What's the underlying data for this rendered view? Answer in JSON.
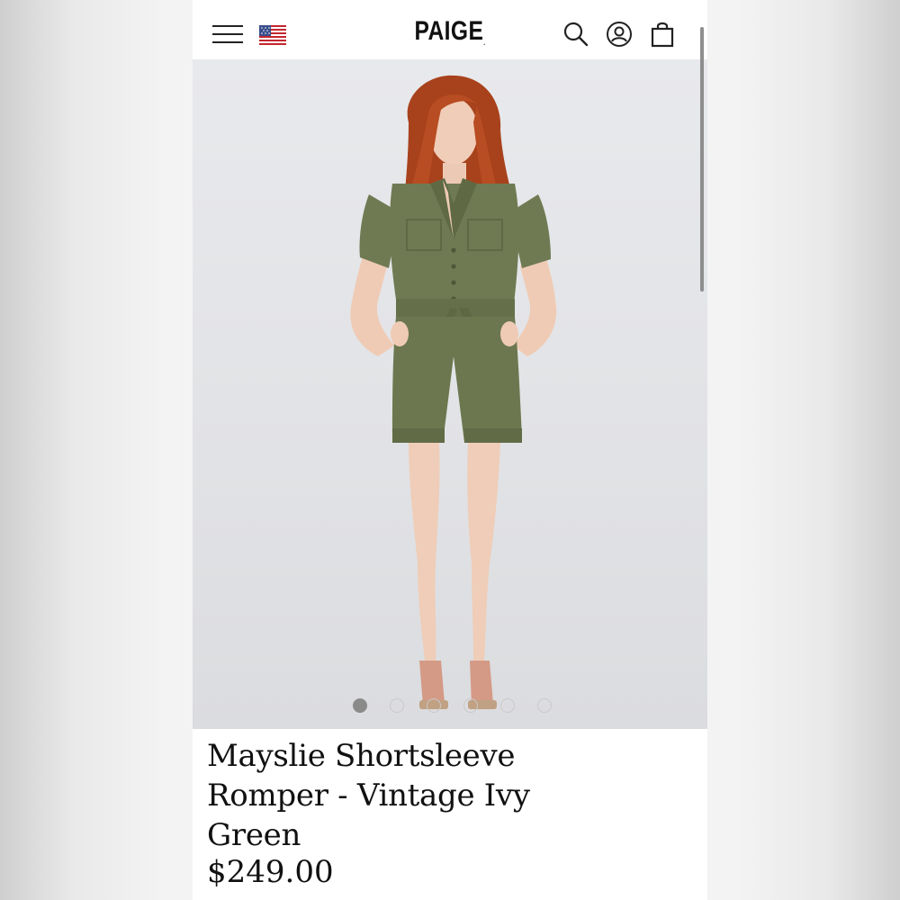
{
  "header": {
    "brand": "PAIGE",
    "brand_mark": ".",
    "menu_icon": "hamburger-menu-icon",
    "flag_icon": "us-flag-icon",
    "search_icon": "search-icon",
    "account_icon": "account-icon",
    "bag_icon": "shopping-bag-icon"
  },
  "product": {
    "title": "Mayslie Shortsleeve\nRomper - Vintage Ivy\nGreen",
    "price": "$249.00",
    "image_count": 6,
    "active_image": 1
  },
  "colors": {
    "romper": "#6f7a53",
    "hair": "#b1481f",
    "hero_bg": "#e2e3e6"
  }
}
